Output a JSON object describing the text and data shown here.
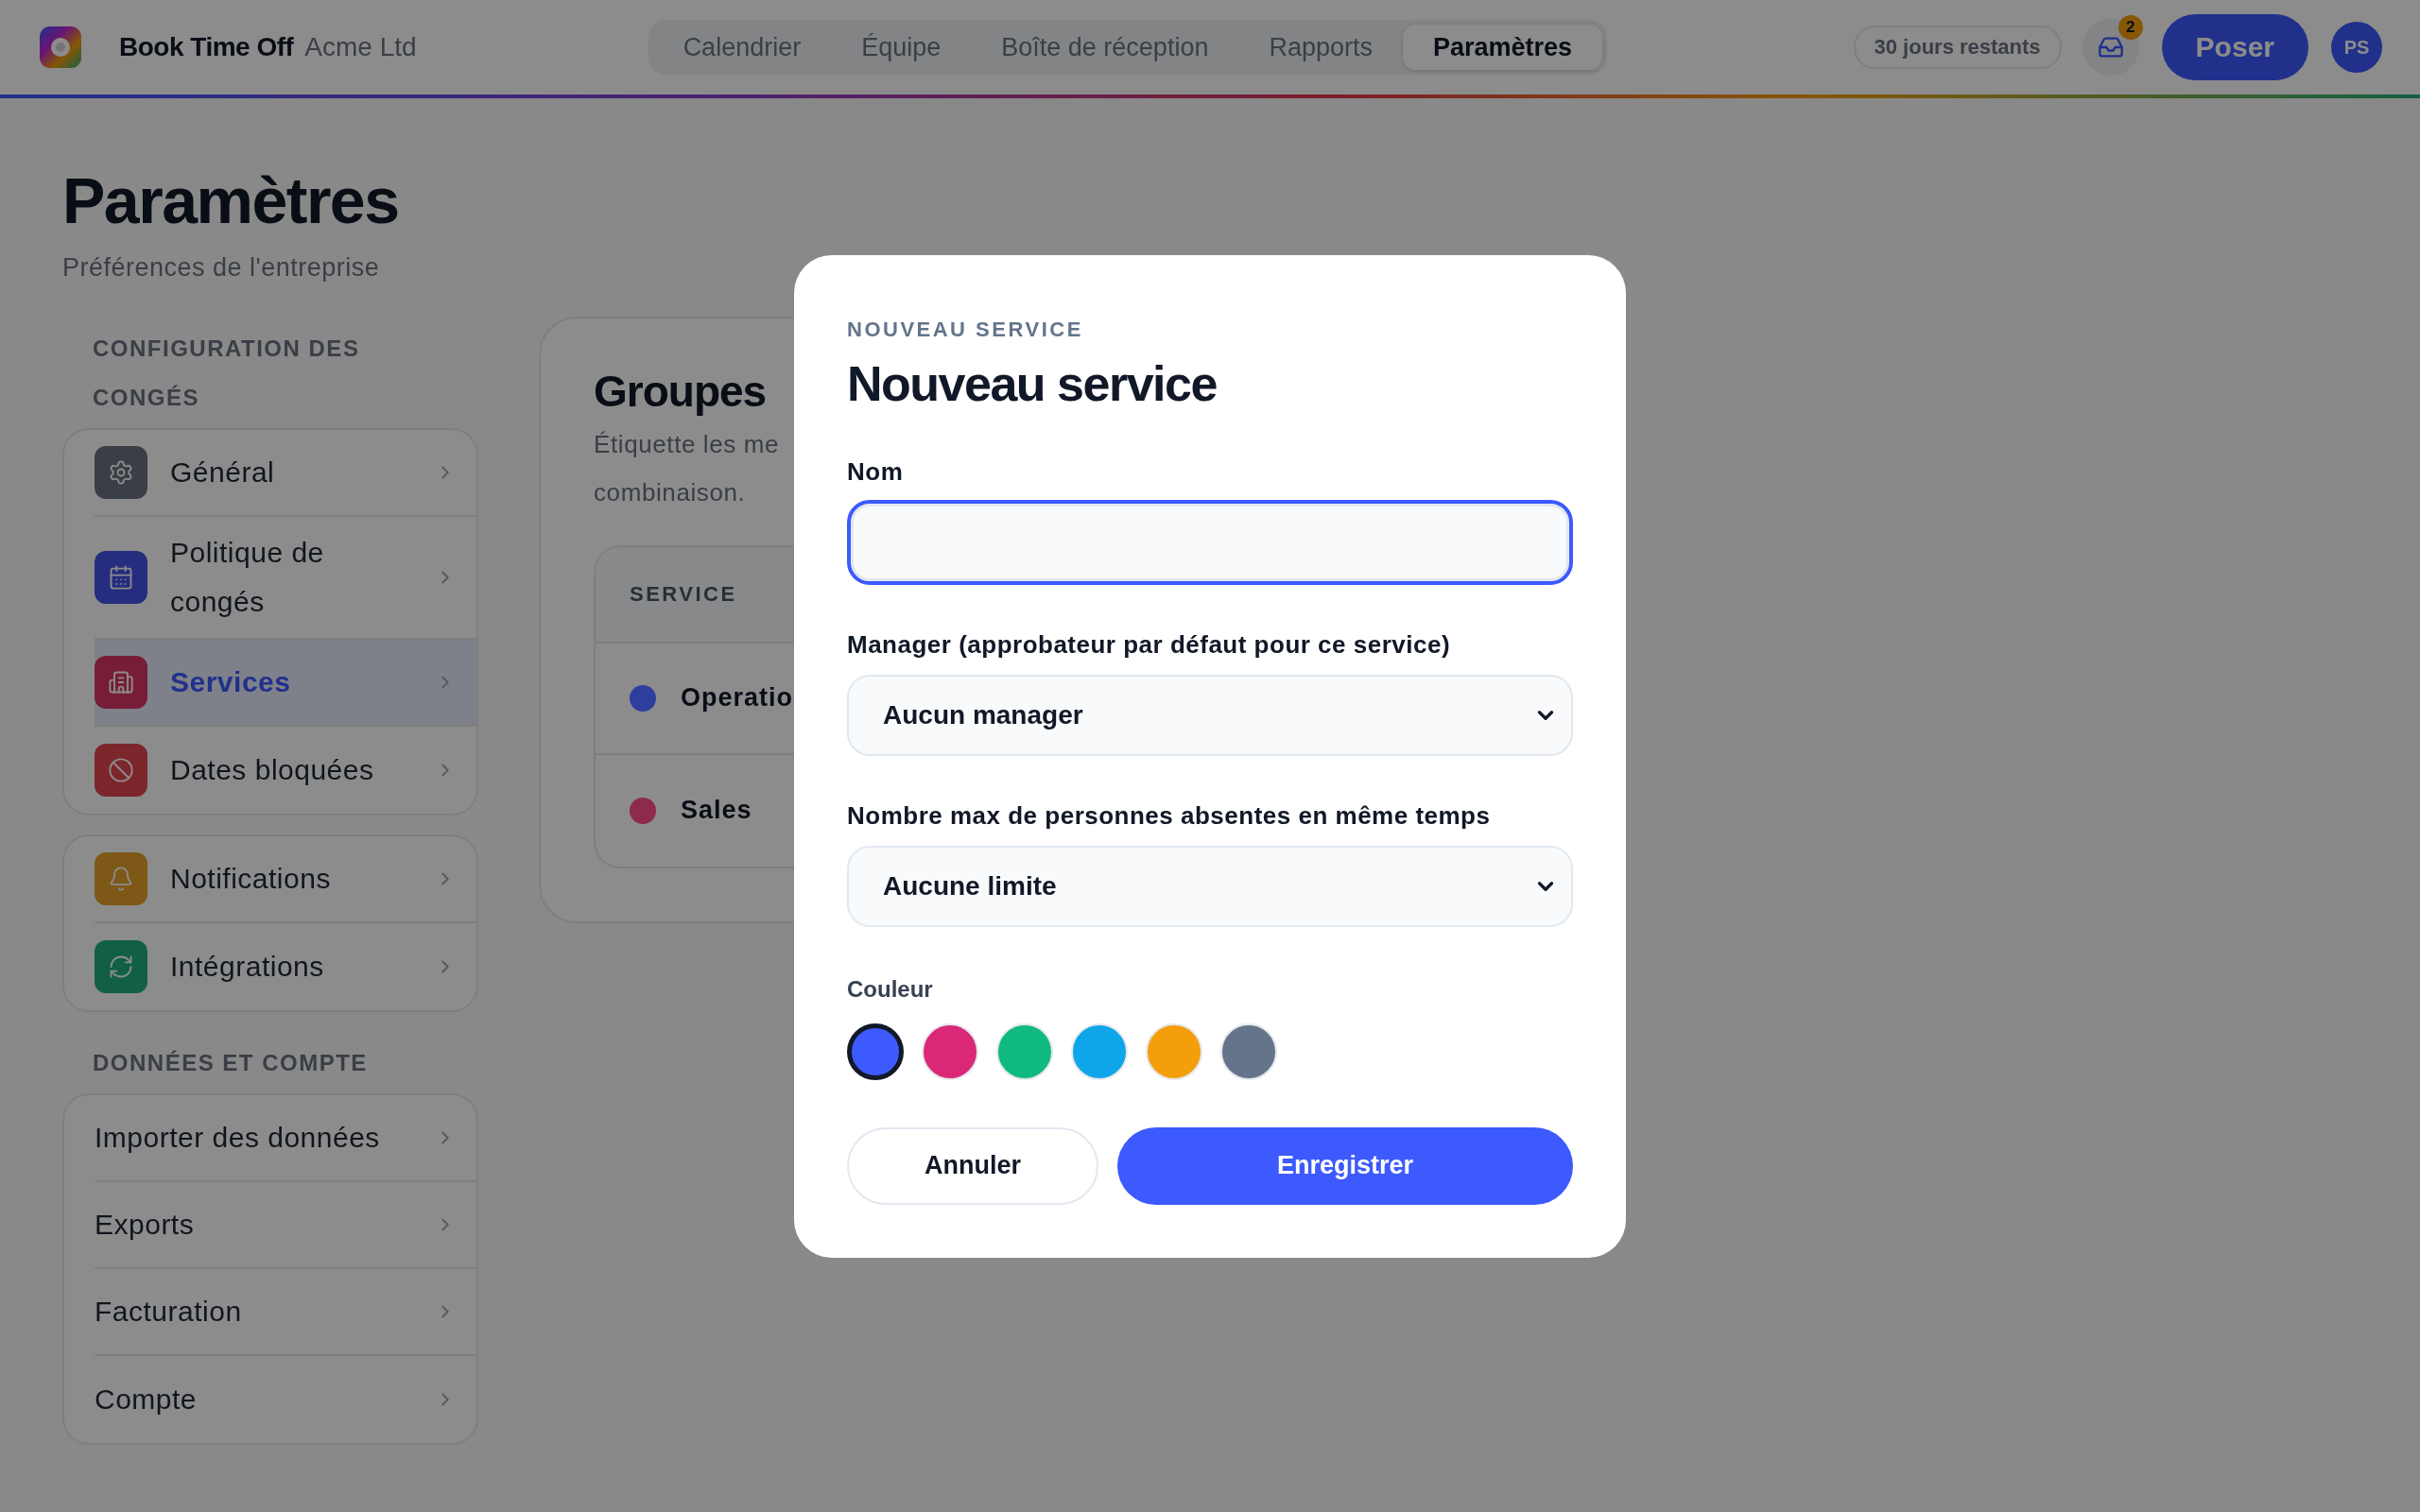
{
  "app": {
    "name": "Book Time Off",
    "org": "Acme Ltd"
  },
  "tabs": [
    {
      "label": "Calendrier",
      "selected": false
    },
    {
      "label": "Équipe",
      "selected": false
    },
    {
      "label": "Boîte de réception",
      "selected": false
    },
    {
      "label": "Rapports",
      "selected": false
    },
    {
      "label": "Paramètres",
      "selected": true
    }
  ],
  "top_right": {
    "days_left": "30 jours restants",
    "inbox_badge": "2",
    "primary_button": "Poser",
    "avatar": "PS"
  },
  "page": {
    "title": "Paramètres",
    "subtitle": "Préférences de l'entreprise"
  },
  "sidebar": [
    {
      "heading": "CONFIGURATION DES CONGÉS",
      "items": [
        {
          "label": "Général",
          "kind": "settings",
          "selected": false
        },
        {
          "label": "Politique de congés",
          "kind": "calendar",
          "selected": false
        },
        {
          "label": "Services",
          "kind": "building",
          "selected": true
        },
        {
          "label": "Dates bloquées",
          "kind": "ban",
          "selected": false
        }
      ]
    },
    {
      "items": [
        {
          "label": "Notifications",
          "kind": "bell",
          "selected": false
        },
        {
          "label": "Intégrations",
          "kind": "refresh",
          "selected": false
        }
      ]
    },
    {
      "heading": "DONNÉES ET COMPTE",
      "items": [
        {
          "label": "Importer des données",
          "selected": false
        },
        {
          "label": "Exports",
          "selected": false
        },
        {
          "label": "Facturation",
          "selected": false
        },
        {
          "label": "Compte",
          "selected": false
        }
      ]
    }
  ],
  "groups_card": {
    "title": "Groupes",
    "description_lines": [
      "Étiquette les me",
      "combinaison."
    ],
    "table": {
      "columns": [
        "SERVICE"
      ],
      "rows": [
        {
          "name": "Operatio",
          "color": "#2f3e9e"
        },
        {
          "name": "Sales",
          "color": "#8e2a4c"
        }
      ]
    }
  },
  "modal": {
    "overline": "NOUVEAU SERVICE",
    "title": "Nouveau service",
    "name_field": {
      "label": "Nom",
      "focused": true
    },
    "manager_field": {
      "label": "Manager (approbateur par défaut pour ce service)",
      "value": "Aucun manager"
    },
    "limit_field": {
      "label": "Nombre max de personnes absentes en même temps",
      "value": "Aucune limite"
    },
    "color_field": {
      "label": "Couleur",
      "swatches": [
        {
          "color": "#3d5afe",
          "selected": true
        },
        {
          "color": "#db2777",
          "selected": false
        },
        {
          "color": "#10b981",
          "selected": false
        },
        {
          "color": "#0ea5e9",
          "selected": false
        },
        {
          "color": "#f59e0b",
          "selected": false
        },
        {
          "color": "#64748b",
          "selected": false
        }
      ]
    },
    "buttons": {
      "cancel": "Annuler",
      "save": "Enregistrer"
    }
  }
}
